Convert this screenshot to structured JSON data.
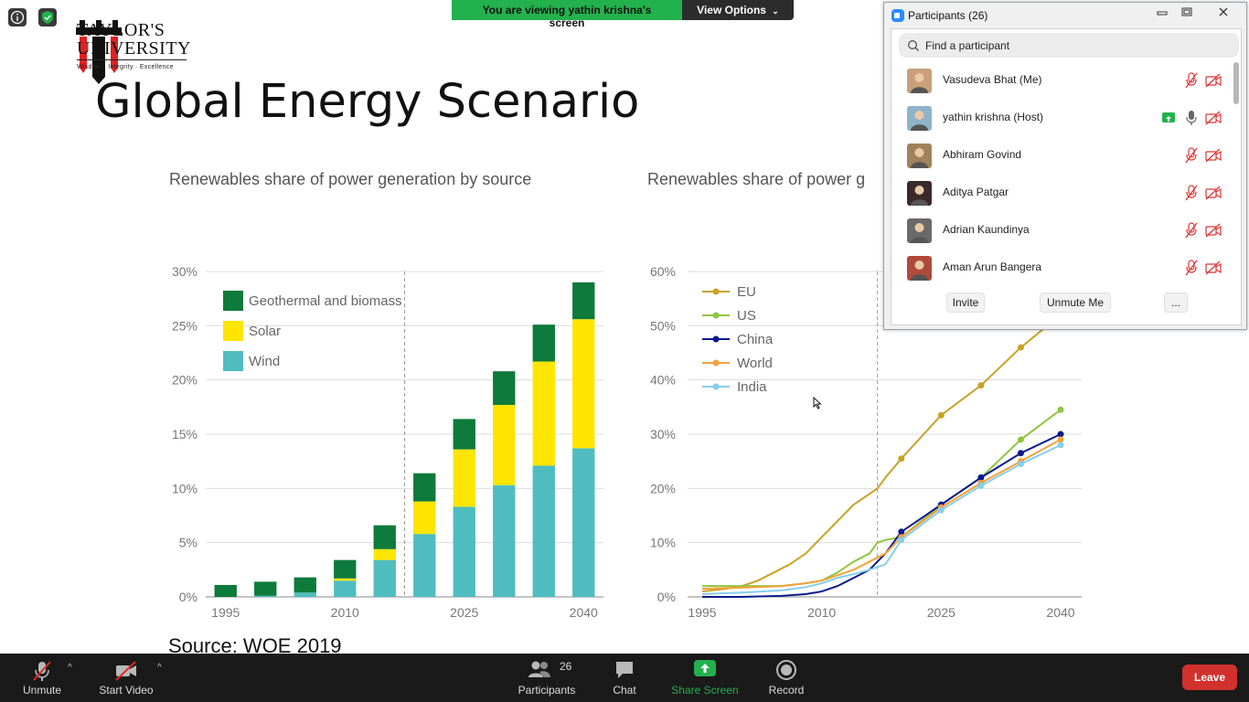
{
  "presenter": {
    "logo_line1": "TAYLOR'S",
    "logo_line2": "UNIVERSITY",
    "logo_tagline": "Wisdom · Integrity · Excellence"
  },
  "slide": {
    "title": "Global Energy Scenario",
    "source": "Source:  WOE 2019"
  },
  "share_banner": {
    "text": "You are viewing yathin krishna's screen",
    "view_options": "View Options",
    "view_options_icon": "chevron-down-icon"
  },
  "participants_panel": {
    "title": "Participants (26)",
    "search_placeholder": "Find a participant",
    "participants": [
      {
        "name": "Vasudeva Bhat (Me)",
        "mic": "muted",
        "video": "off",
        "sharing": false
      },
      {
        "name": "yathin krishna (Host)",
        "mic": "on",
        "video": "off",
        "sharing": true
      },
      {
        "name": "Abhiram Govind",
        "mic": "muted",
        "video": "off",
        "sharing": false
      },
      {
        "name": "Aditya Patgar",
        "mic": "muted",
        "video": "off",
        "sharing": false
      },
      {
        "name": "Adrian Kaundinya",
        "mic": "muted",
        "video": "off",
        "sharing": false
      },
      {
        "name": "Aman Arun Bangera",
        "mic": "muted",
        "video": "off",
        "sharing": false
      }
    ],
    "buttons": {
      "invite": "Invite",
      "unmute_me": "Unmute Me",
      "more": "..."
    }
  },
  "toolbar": {
    "unmute": "Unmute",
    "start_video": "Start Video",
    "participants": "Participants",
    "participants_count": "26",
    "chat": "Chat",
    "share_screen": "Share Screen",
    "record": "Record",
    "leave": "Leave"
  },
  "colors": {
    "geothermal": "#0e7a3c",
    "solar": "#ffe500",
    "wind": "#4fbdc0",
    "eu": "#c9a227",
    "us": "#8dc63f",
    "china": "#0a1a8c",
    "world": "#f2a23a",
    "india": "#87ceeb",
    "share_green": "#23b14d",
    "leave_red": "#d0312d"
  },
  "chart_data": [
    {
      "type": "bar",
      "title": "Renewables share of power generation by source",
      "x_ticks": [
        "1995",
        "2010",
        "2025",
        "2040"
      ],
      "categories": [
        "1995",
        "2000",
        "2005",
        "2010",
        "2015",
        "2020",
        "2025",
        "2030",
        "2035",
        "2040"
      ],
      "series": [
        {
          "name": "Wind",
          "values": [
            0.0,
            0.1,
            0.4,
            1.5,
            3.4,
            5.8,
            8.3,
            10.3,
            12.1,
            13.7
          ]
        },
        {
          "name": "Solar",
          "values": [
            0.0,
            0.0,
            0.0,
            0.2,
            1.0,
            3.0,
            5.3,
            7.4,
            9.6,
            11.9
          ]
        },
        {
          "name": "Geothermal and biomass",
          "values": [
            1.1,
            1.3,
            1.4,
            1.7,
            2.2,
            2.6,
            2.8,
            3.1,
            3.4,
            3.4
          ]
        }
      ],
      "stacked": true,
      "y_ticks": [
        "0%",
        "5%",
        "10%",
        "15%",
        "20%",
        "25%",
        "30%"
      ],
      "ylim": [
        0,
        30
      ],
      "projection_divider_after": "2015",
      "legend": "top-left",
      "grid": true
    },
    {
      "type": "line",
      "title": "Renewables share of power g",
      "x_ticks": [
        "1995",
        "2010",
        "2025",
        "2040"
      ],
      "xlim": [
        1995,
        2040
      ],
      "y_ticks": [
        "0%",
        "10%",
        "20%",
        "30%",
        "40%",
        "50%",
        "60%"
      ],
      "ylim": [
        0,
        60
      ],
      "projection_divider_at": 2017,
      "legend": "top-left",
      "grid": true,
      "series": [
        {
          "name": "EU",
          "x": [
            1995,
            1998,
            2000,
            2002,
            2004,
            2006,
            2008,
            2010,
            2012,
            2014,
            2016,
            2017,
            2018,
            2020,
            2025,
            2030,
            2035,
            2040
          ],
          "y": [
            1,
            1.5,
            2,
            3,
            4.5,
            6,
            8,
            11,
            14,
            17,
            19,
            20,
            22,
            25.5,
            33.5,
            39,
            46,
            52
          ]
        },
        {
          "name": "US",
          "x": [
            1995,
            2000,
            2005,
            2008,
            2010,
            2012,
            2014,
            2016,
            2017,
            2018,
            2020,
            2025,
            2030,
            2035,
            2040
          ],
          "y": [
            2,
            2,
            2,
            2.5,
            3,
            4.5,
            6.5,
            8,
            10,
            10.5,
            11,
            17,
            22,
            29,
            34.5
          ]
        },
        {
          "name": "China",
          "x": [
            1995,
            2000,
            2005,
            2008,
            2010,
            2012,
            2014,
            2016,
            2018,
            2020,
            2025,
            2030,
            2035,
            2040
          ],
          "y": [
            0,
            0,
            0.2,
            0.5,
            1,
            2,
            3.5,
            5,
            8,
            12,
            17,
            22,
            26.5,
            30
          ]
        },
        {
          "name": "World",
          "x": [
            1995,
            2000,
            2005,
            2008,
            2010,
            2012,
            2014,
            2016,
            2018,
            2020,
            2025,
            2030,
            2035,
            2040
          ],
          "y": [
            1.5,
            1.7,
            2,
            2.5,
            3,
            4,
            5,
            6.5,
            8,
            11,
            16.5,
            21,
            25,
            29
          ]
        },
        {
          "name": "India",
          "x": [
            1995,
            2000,
            2005,
            2008,
            2010,
            2012,
            2014,
            2016,
            2018,
            2020,
            2025,
            2030,
            2035,
            2040
          ],
          "y": [
            0.5,
            0.8,
            1.2,
            1.8,
            2.5,
            3.5,
            4.2,
            5,
            6,
            10.5,
            16,
            20.5,
            24.5,
            28
          ]
        }
      ]
    }
  ]
}
